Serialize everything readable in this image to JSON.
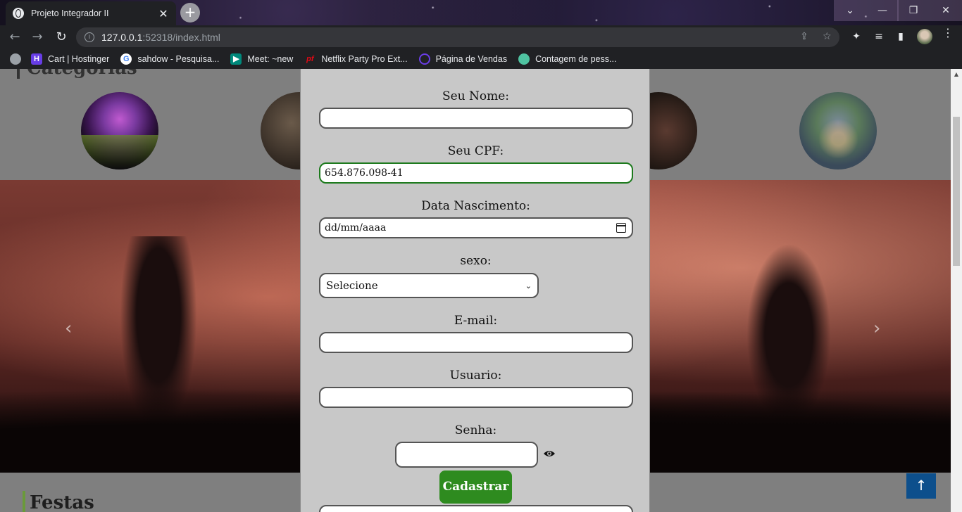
{
  "browser": {
    "tab_title": "Projeto Integrador II",
    "tab_close": "✕",
    "new_tab": "+",
    "url_host": "127.0.0.1",
    "url_rest": ":52318/index.html",
    "window_controls": [
      "⌄",
      "—",
      "❐",
      "✕"
    ],
    "bookmarks": [
      {
        "label": "Cart | Hostinger",
        "icon": "hostinger-icon",
        "color": "#673de6"
      },
      {
        "label": "sahdow - Pesquisa...",
        "icon": "google-icon",
        "color": "#ffffff"
      },
      {
        "label": "Meet: ~new",
        "icon": "meet-icon",
        "color": "#00897b"
      },
      {
        "label": "Netflix Party Pro Ext...",
        "icon": "netflix-party-icon",
        "color": "#e50914"
      },
      {
        "label": "Página de Vendas",
        "icon": "vendas-icon",
        "color": "#6a3de6"
      },
      {
        "label": "Contagem de pess...",
        "icon": "contagem-icon",
        "color": "#4fc3a1"
      }
    ]
  },
  "page": {
    "categories_heading": "Categorias",
    "festas_heading": "Festas",
    "carousel_prev": "‹",
    "carousel_next": "›",
    "back_to_top": "↑"
  },
  "form": {
    "name_label": "Seu Nome:",
    "name_value": "",
    "cpf_label": "Seu CPF:",
    "cpf_value": "654.876.098-41",
    "birth_label": "Data Nascimento:",
    "birth_placeholder": "dd/mm/aaaa",
    "sex_label": "sexo:",
    "sex_selected": "Selecione",
    "email_label": "E-mail:",
    "email_value": "",
    "user_label": "Usuario:",
    "user_value": "",
    "password_label": "Senha:",
    "submit_label": "Cadastrar"
  },
  "colors": {
    "submit_bg": "#2e8b1f",
    "valid_border": "#1d7a1d",
    "back_to_top_bg": "#0d4f8c"
  }
}
